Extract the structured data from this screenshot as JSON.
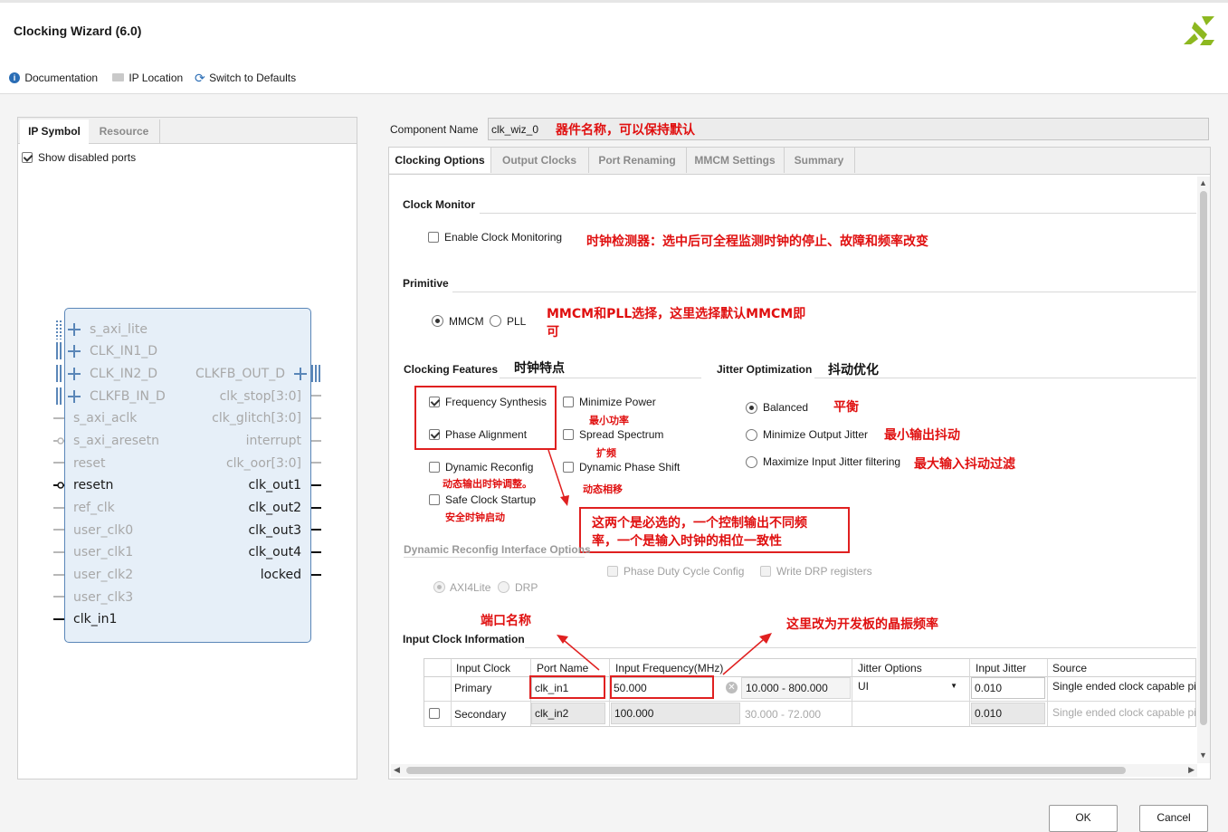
{
  "header": {
    "title": "Clocking Wizard (6.0)",
    "toolbar": {
      "documentation": "Documentation",
      "ip_location": "IP Location",
      "switch_defaults": "Switch to Defaults"
    }
  },
  "left_panel": {
    "tabs": [
      "IP Symbol",
      "Resource"
    ],
    "show_disabled_ports": "Show disabled ports",
    "symbol": {
      "left_bus_ports": [
        "s_axi_lite",
        "CLK_IN1_D",
        "CLK_IN2_D",
        "CLKFB_IN_D"
      ],
      "left_ports": [
        "s_axi_aclk",
        "s_axi_aresetn",
        "reset",
        "resetn",
        "ref_clk",
        "user_clk0",
        "user_clk1",
        "user_clk2",
        "user_clk3",
        "clk_in1"
      ],
      "right_ports": [
        "CLKFB_OUT_D",
        "clk_stop[3:0]",
        "clk_glitch[3:0]",
        "interrupt",
        "clk_oor[3:0]",
        "clk_out1",
        "clk_out2",
        "clk_out3",
        "clk_out4",
        "locked"
      ]
    }
  },
  "component": {
    "label": "Component Name",
    "value": "clk_wiz_0"
  },
  "tabs": [
    "Clocking Options",
    "Output Clocks",
    "Port Renaming",
    "MMCM Settings",
    "Summary"
  ],
  "clock_monitor": {
    "title": "Clock Monitor",
    "enable": "Enable Clock Monitoring"
  },
  "primitive": {
    "title": "Primitive",
    "options": [
      "MMCM",
      "PLL"
    ]
  },
  "clocking_features": {
    "title": "Clocking Features",
    "frequency_synthesis": "Frequency Synthesis",
    "minimize_power": "Minimize Power",
    "phase_alignment": "Phase Alignment",
    "spread_spectrum": "Spread Spectrum",
    "dynamic_reconfig": "Dynamic Reconfig",
    "dynamic_phase_shift": "Dynamic Phase Shift",
    "safe_clock_startup": "Safe Clock Startup"
  },
  "jitter": {
    "title": "Jitter Optimization",
    "balanced": "Balanced",
    "min_output": "Minimize Output Jitter",
    "max_input": "Maximize Input Jitter filtering"
  },
  "dynamic_reconfig_interface": {
    "title": "Dynamic Reconfig Interface Options",
    "axi": "AXI4Lite",
    "drp": "DRP",
    "phase_duty": "Phase Duty Cycle Config",
    "write_drp": "Write DRP registers"
  },
  "input_clock": {
    "title": "Input Clock Information",
    "headers": [
      "Input Clock",
      "Port Name",
      "Input Frequency(MHz)",
      "Jitter Options",
      "Input Jitter",
      "Source"
    ],
    "rows": [
      {
        "clock": "Primary",
        "port": "clk_in1",
        "freq": "50.000",
        "range": "10.000 - 800.000",
        "jitter_opt": "UI",
        "jitter": "0.010",
        "source": "Single ended clock capable pin"
      },
      {
        "clock": "Secondary",
        "port": "clk_in2",
        "freq": "100.000",
        "range": "30.000 - 72.000",
        "jitter_opt": "",
        "jitter": "0.010",
        "source": "Single ended clock capable pin"
      }
    ]
  },
  "annotations": {
    "component": "器件名称，可以保持默认",
    "monitor": "时钟检测器：选中后可全程监测时钟的停止、故障和频率改变",
    "primitive_1": "MMCM和PLL选择，这里选择默认MMCM即",
    "primitive_2": "可",
    "features": "时钟特点",
    "jitter": "抖动优化",
    "balanced": "平衡",
    "min_output": "最小输出抖动",
    "max_input": "最大输入抖动过滤",
    "min_power": "最小功率",
    "spread": "扩频",
    "dyn_reconfig": "动态输出时钟调整。",
    "dyn_phase": "动态相移",
    "safe_startup": "安全时钟启动",
    "required_1": "这两个是必选的，一个控制输出不同频",
    "required_2": "率，一个是输入时钟的相位一致性",
    "port_name": "端口名称",
    "freq": "这里改为开发板的晶振频率"
  },
  "footer": {
    "ok": "OK",
    "cancel": "Cancel"
  },
  "colors": {
    "annotation": "#e01010",
    "logo": "#8db820"
  }
}
